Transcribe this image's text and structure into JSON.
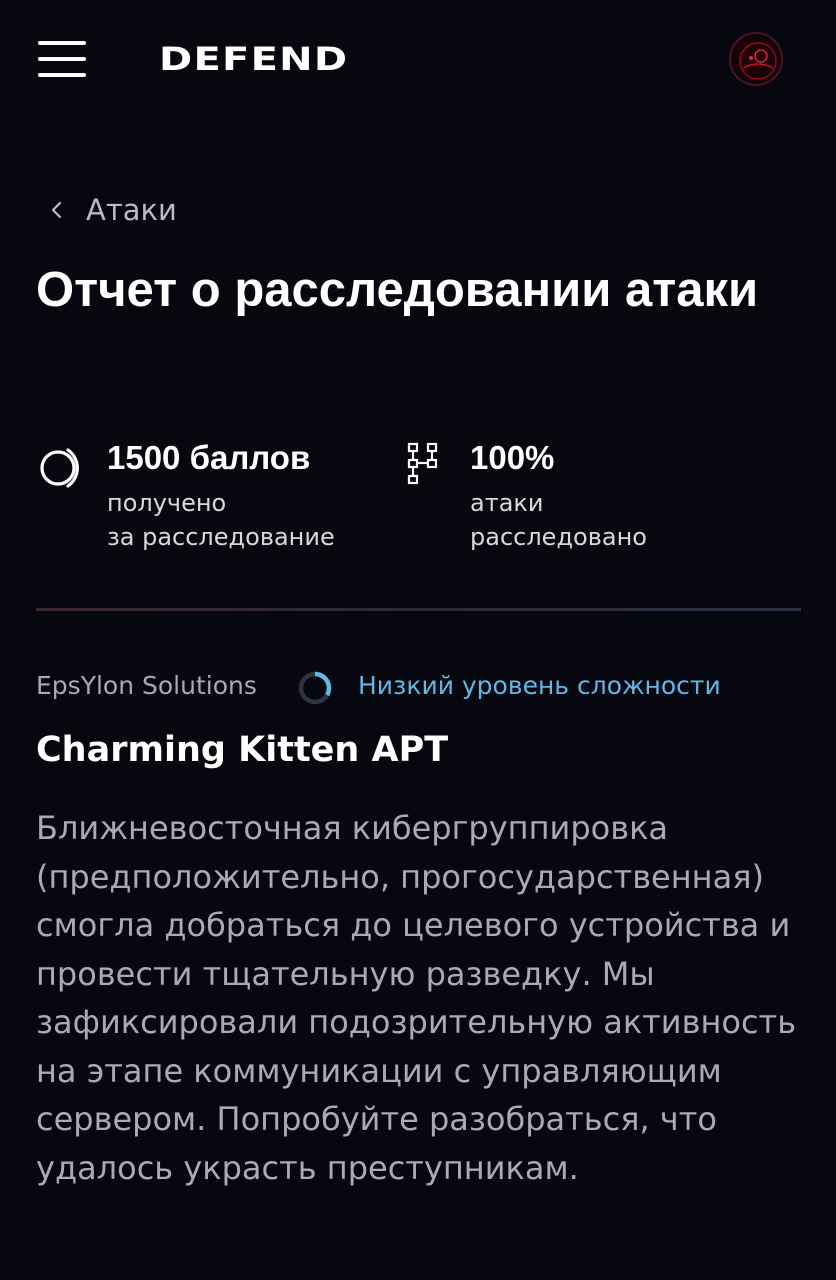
{
  "header": {
    "menu_icon": "hamburger-menu-icon",
    "logo_text": "DEFEND",
    "avatar_icon": "user-avatar-icon"
  },
  "breadcrumb": {
    "icon": "chevron-left-icon",
    "label": "Атаки"
  },
  "page_title": "Отчет о расследовании атаки",
  "stats": [
    {
      "icon": "points-ring-icon",
      "value": "1500 баллов",
      "line1": "получено",
      "line2": "за расследование"
    },
    {
      "icon": "network-nodes-icon",
      "value": "100%",
      "line1": "атаки",
      "line2": "расследовано"
    }
  ],
  "meta": {
    "company": "EpsYlon Solutions",
    "difficulty_icon": "difficulty-gauge-icon",
    "difficulty": "Низкий уровень сложности"
  },
  "attack_name": "Charming Kitten APT",
  "description": "Ближневосточная кибергруппировка (предположительно, прогосударственная) смогла добраться до целевого устройства и провести тщательную разведку. Мы зафиксировали подозрительную активность на этапе коммуникации с управляющим сервером. Попробуйте разобраться, что удалось украсть преступникам.",
  "colors": {
    "background": "#07070f",
    "accent_blue": "#62b7e7",
    "muted_text": "#a9aab3"
  }
}
